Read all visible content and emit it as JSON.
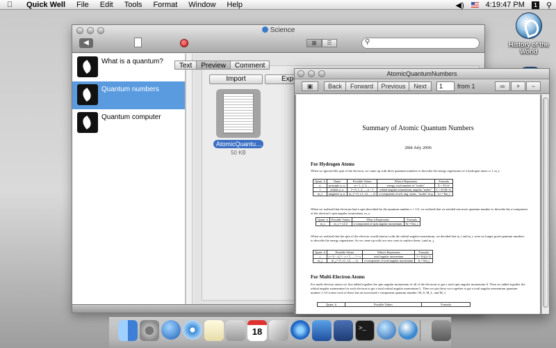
{
  "menubar": {
    "app": "Quick Well",
    "items": [
      "File",
      "Edit",
      "Tools",
      "Format",
      "Window",
      "Help"
    ],
    "clock": "4:19:47 PM",
    "user_initial": "1"
  },
  "desktop": {
    "item_label": "History of the World"
  },
  "quickwell": {
    "title": "Science",
    "search_placeholder": "",
    "sidebar": [
      {
        "label": "What is a quantum?"
      },
      {
        "label": "Quantum numbers"
      },
      {
        "label": "Quantum computer"
      }
    ],
    "tabs": [
      "Text",
      "Preview",
      "Comment"
    ],
    "active_tab": "Preview",
    "import_label": "Import",
    "export_label": "Export",
    "attachment": {
      "name": "AtomicQuantu…",
      "size": "50 KB"
    }
  },
  "preview": {
    "title": "AtomicQuantumNumbers",
    "buttons": {
      "back": "Back",
      "forward": "Forward",
      "previous": "Previous",
      "next": "Next"
    },
    "page_value": "1",
    "from_label": "from 1",
    "zoom": {
      "plus": "+",
      "minus": "−"
    }
  },
  "document": {
    "title": "Summary of Atomic Quantum Numbers",
    "date": "28th July 2006",
    "section1": "For Hydrogen Atoms",
    "para1": "When we ignored the spin of the electron, we came up with three quantum numbers to describe the energy eigenstates of a hydrogen atom: n, l, m_l.",
    "table1": {
      "headers": [
        "Quant. #",
        "Name",
        "Possible Values",
        "What it Represents",
        "Formula"
      ],
      "rows": [
        [
          "n",
          "principle q. n.",
          "n = 1, 2, 3, ...",
          "energy, total number of \"nodes\"",
          "E = E1/n²"
        ],
        [
          "l",
          "orbital q. n.",
          "l = 0, 1, 2, ..., n − 1",
          "orbital angular momentum, angular \"nodes\"",
          "L = ħ√l(l+1)"
        ],
        [
          "m_l",
          "magnetic q. n.",
          "m_l = 0, ±1, ±2, ..., ±l",
          "z-component of orb. ang. mom., \"nodes\" in φ",
          "Lz = ħm_l"
        ]
      ]
    },
    "para2": "When we realized that electrons had a spin described by the quantum number s = 1/2, we realized that we needed one more quantum number to describe the z-component of the electron's spin angular momentum, m_s.",
    "table2": {
      "headers": [
        "Quant. #",
        "Possible Values",
        "What it Represents",
        "Formula"
      ],
      "rows": [
        [
          "m_s",
          "m_s = ±1/2",
          "z-component of spin angular momentum",
          "Sz = ħm_s"
        ]
      ]
    },
    "para3": "When we realized that the spin of the electron would interact with the orbital angular momentum, we decided that m_l and m_s were no longer good quantum numbers to describe the energy eigenstates. So we came up with two new ones to replace them: j and m_j.",
    "table3": {
      "headers": [
        "Quant. #",
        "Possible Values",
        "What it Represents",
        "Formula"
      ],
      "rows": [
        [
          "j",
          "j = |l − s|, l − s + 1, ..., l + s",
          "total angular momentum",
          "J = ħ√j(j+1)"
        ],
        [
          "m_j",
          "m_j = 0, ±1, ±2, ..., ±j",
          "z-component of total angular momentum",
          "Jz = ħm_j"
        ]
      ]
    },
    "section2": "For Multi-Electron Atoms",
    "para4": "For multi-electron atoms we first added together the spin angular momentum of all of the electrons to get a total spin angular momentum S. Then we added together the orbital angular momentum for each electron to get a total orbital angular momentum L. Then we put those two together to get a total angular momentum quantum number J. Of course each of these has an associated z-component quantum number: M_S, M_L, and M_J.",
    "table4": {
      "headers": [
        "Quant. #",
        "Possible Values",
        "Formula"
      ]
    }
  },
  "dock": {
    "calendar_day": "18",
    "terminal_text": ">_"
  },
  "colors": {
    "selection": "#5a9be0",
    "attachment_label": "#3a6fc4",
    "record": "#c61414"
  }
}
